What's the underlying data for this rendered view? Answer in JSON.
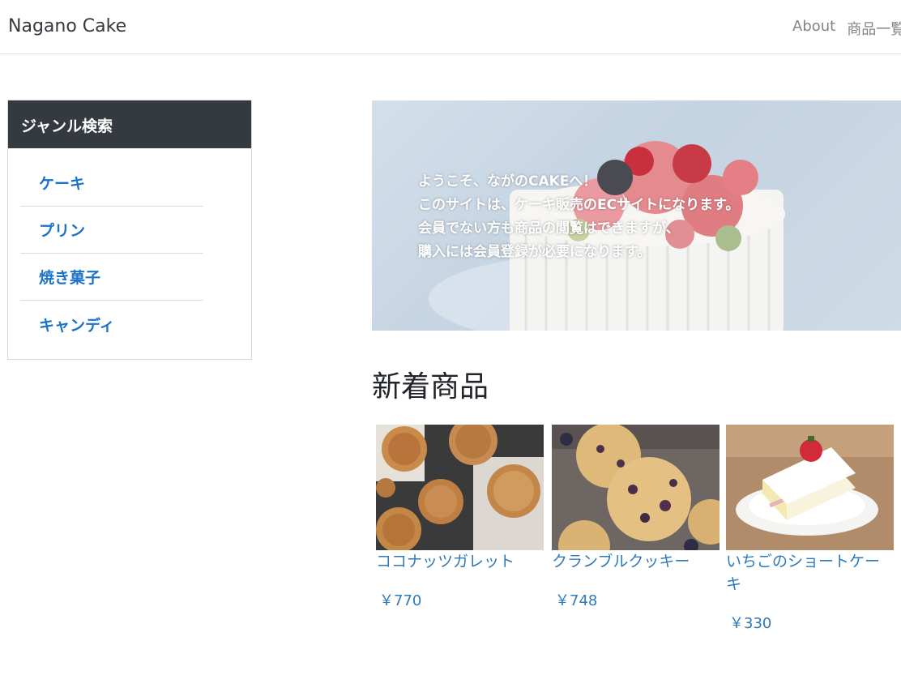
{
  "navbar": {
    "brand": "Nagano Cake",
    "links": [
      "About",
      "商品一覧"
    ]
  },
  "sidebar": {
    "title": "ジャンル検索",
    "genres": [
      "ケーキ",
      "プリン",
      "焼き菓子",
      "キャンディ"
    ]
  },
  "hero": {
    "lines": [
      "ようこそ、ながのCAKEへ！",
      "このサイトは、ケーキ販売のECサイトになります。",
      "会員でない方も商品の閲覧はできますが、",
      "購入には会員登録が必要になります。"
    ]
  },
  "new_items": {
    "title": "新着商品",
    "products": [
      {
        "name": "ココナッツガレット",
        "price": "￥770"
      },
      {
        "name": "クランブルクッキー",
        "price": "￥748"
      },
      {
        "name": "いちごのショートケーキ",
        "price": "￥330"
      }
    ]
  }
}
